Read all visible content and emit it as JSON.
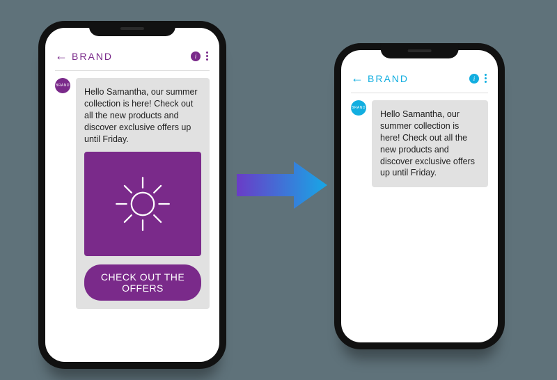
{
  "colors": {
    "purple": "#7a2a8a",
    "blue": "#12aee0"
  },
  "left": {
    "brand": "BRAND",
    "avatar": "BRAND",
    "message": {
      "a": "Hello Samantha, our summer collection is here!",
      "b": "Check out all the new products",
      "c": " and discover exclusive offers up until Friday."
    },
    "cta": "CHECK OUT THE OFFERS"
  },
  "right": {
    "brand": "BRAND",
    "avatar": "BRAND",
    "message": {
      "a": "Hello Samantha, our summer collection is here!",
      "b": " Check out all the new products",
      "c": " and discover exclusive offers up until Friday."
    }
  }
}
